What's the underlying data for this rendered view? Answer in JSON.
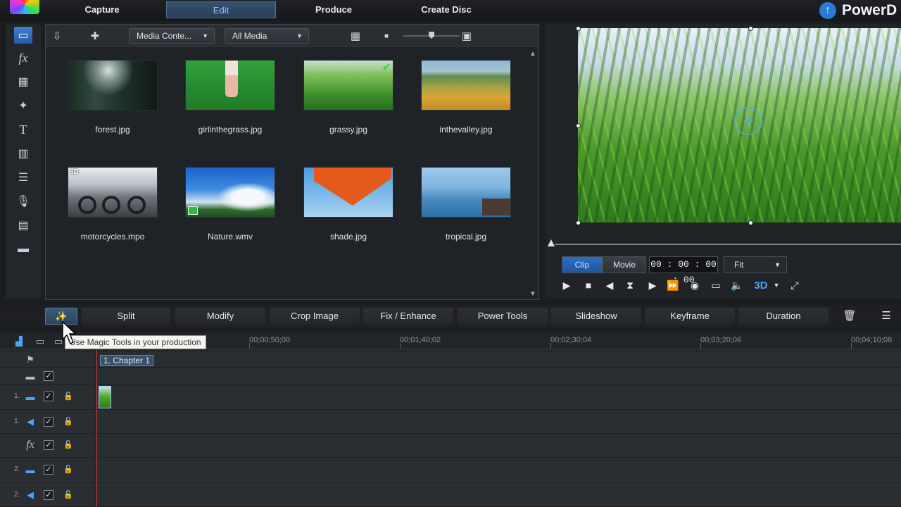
{
  "app": {
    "brand": "PowerD"
  },
  "modes": [
    {
      "label": "Capture",
      "active": false
    },
    {
      "label": "Edit",
      "active": true
    },
    {
      "label": "Produce",
      "active": false
    },
    {
      "label": "Create Disc",
      "active": false
    }
  ],
  "media_toolbar": {
    "content_dropdown": "Media Conte...",
    "filter_dropdown": "All Media"
  },
  "media_items": [
    {
      "name": "forest.jpg"
    },
    {
      "name": "girlinthegrass.jpg"
    },
    {
      "name": "grassy.jpg",
      "in_use": true
    },
    {
      "name": "inthevalley.jpg"
    },
    {
      "name": "motorcycles.mpo",
      "badge": "3D"
    },
    {
      "name": "Nature.wmv",
      "is_video": true
    },
    {
      "name": "shade.jpg"
    },
    {
      "name": "tropical.jpg"
    }
  ],
  "preview": {
    "clip_label": "Clip",
    "movie_label": "Movie",
    "mode_active": "Clip",
    "timecode": "00 : 00 : 00 : 00",
    "fit": "Fit",
    "three_d": "3D"
  },
  "functions": [
    "Split",
    "Modify",
    "Crop Image",
    "Fix / Enhance",
    "Power Tools",
    "Slideshow",
    "Keyframe",
    "Duration"
  ],
  "tooltip": "Use Magic Tools in your production",
  "timeline": {
    "ruler_labels": [
      "00;00;50;00",
      "00;01;40;02",
      "00;02;30;04",
      "00;03;20;06",
      "00;04;10;08"
    ],
    "chapter": "1. Chapter 1",
    "tracks": [
      {
        "num": "",
        "type": "chapter-icon",
        "checked": false,
        "locked": false
      },
      {
        "num": "",
        "type": "subtitle-icon",
        "checked": true,
        "locked": false
      },
      {
        "num": "1.",
        "type": "video-track-icon",
        "checked": true,
        "locked": true
      },
      {
        "num": "1.",
        "type": "audio-track-icon",
        "checked": true,
        "locked": true
      },
      {
        "num": "",
        "type": "fx-track-icon",
        "checked": true,
        "locked": true
      },
      {
        "num": "2.",
        "type": "video-track-icon",
        "checked": true,
        "locked": true
      },
      {
        "num": "2.",
        "type": "audio-track-icon",
        "checked": true,
        "locked": true
      }
    ]
  },
  "colors": {
    "accent": "#4aa3ff",
    "playhead": "#d23b3b",
    "active_tab": "#8fc4ff"
  }
}
